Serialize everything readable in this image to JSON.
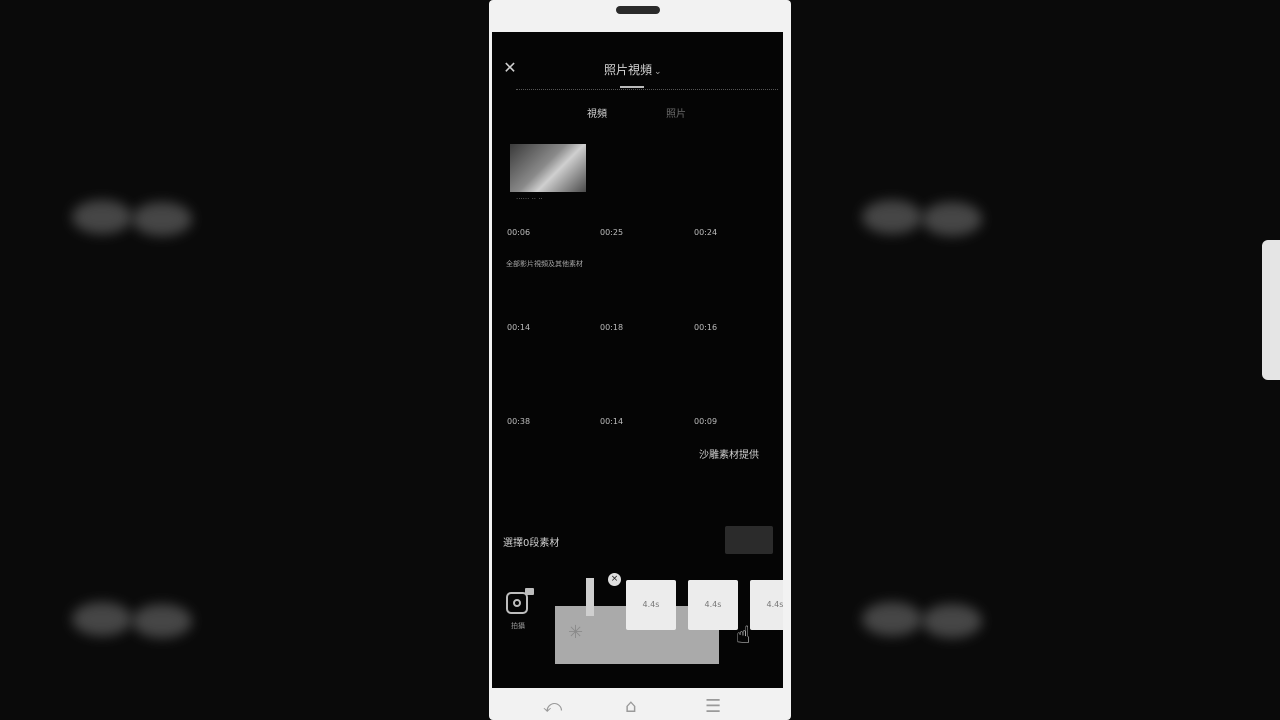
{
  "editor": {
    "title": "照片視頻",
    "tabs": [
      {
        "label": "視頻",
        "active": true
      },
      {
        "label": "照片",
        "active": false
      }
    ],
    "thumb_caption": "······ ·· ··",
    "durations": [
      "00:06",
      "00:25",
      "00:24",
      "00:14",
      "00:18",
      "00:16",
      "00:38",
      "00:14",
      "00:09"
    ],
    "media_text": "全部影片視頻及其他素材",
    "credit": "沙雕素材提供",
    "select_label": "選擇0段素材",
    "camera_label": "拍攝",
    "clip_cards": [
      "4.4s",
      "4.4s",
      "4.4s"
    ]
  },
  "icons": {
    "close": "close-icon",
    "chevron": "chevron-down-icon",
    "camera": "camera-icon",
    "remove": "remove-icon",
    "hand": "hand-pointer-icon",
    "back": "back-icon",
    "home": "home-icon",
    "menu": "menu-icon"
  }
}
